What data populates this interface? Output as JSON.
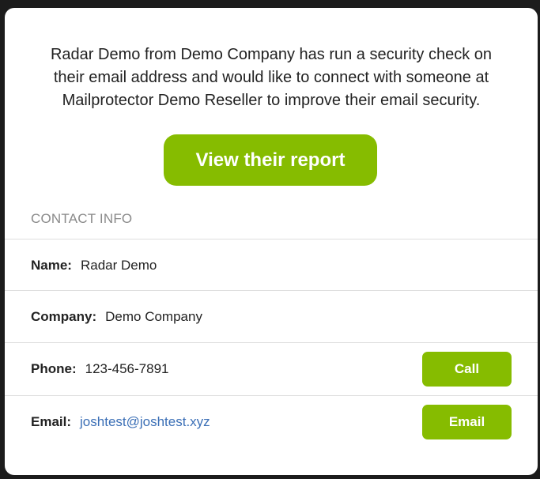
{
  "intro": {
    "line1": "Radar Demo from Demo Company has run a security check on",
    "line2": "their email address and would like to connect with someone at",
    "line3": "Mailprotector Demo Reseller to improve their email security."
  },
  "report_button_label": "View their report",
  "contact": {
    "header": "CONTACT INFO",
    "name": {
      "label": "Name:",
      "value": "Radar Demo"
    },
    "company": {
      "label": "Company:",
      "value": "Demo Company"
    },
    "phone": {
      "label": "Phone:",
      "value": "123-456-7891",
      "action_label": "Call"
    },
    "email": {
      "label": "Email:",
      "value": "joshtest@joshtest.xyz",
      "action_label": "Email"
    }
  },
  "colors": {
    "accent_green": "#86bc00",
    "link_blue": "#3b6fb6",
    "background_dark": "#1c1c1c"
  }
}
